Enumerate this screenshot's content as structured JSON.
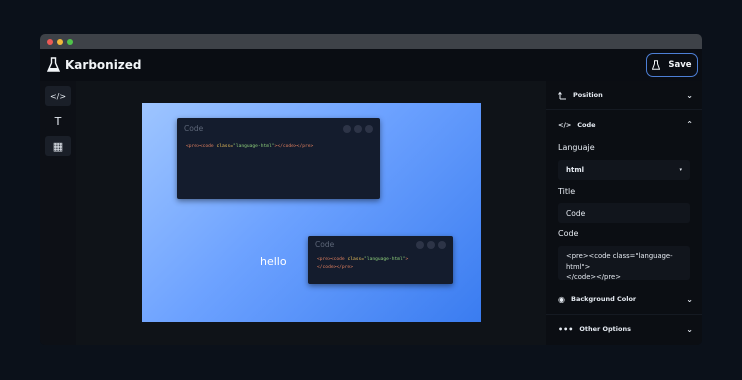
{
  "app": {
    "title": "Karbonized",
    "save_label": "Save"
  },
  "window_dots": [
    "#ec5a55",
    "#f2b83b",
    "#4fc44a"
  ],
  "toolbar": {
    "items": [
      {
        "icon": "code-icon",
        "glyph": "</>"
      },
      {
        "icon": "text-icon",
        "glyph": "T"
      },
      {
        "icon": "qr-code-icon",
        "glyph": "▦"
      }
    ]
  },
  "canvas": {
    "gradient": [
      "#9ec5ff",
      "#3a7cf0"
    ],
    "windows": [
      {
        "title": "Code",
        "lines": [
          [
            {
              "t": "<pre><code ",
              "c": "tag"
            },
            {
              "t": "class=",
              "c": "attr"
            },
            {
              "t": "\"language-html\"",
              "c": "str"
            },
            {
              "t": "></code></pre>",
              "c": "tag"
            }
          ]
        ]
      },
      {
        "title": "Code",
        "lines": [
          [
            {
              "t": "<pre><code ",
              "c": "tag"
            },
            {
              "t": "class=",
              "c": "attr"
            },
            {
              "t": "\"language-html\"",
              "c": "str"
            },
            {
              "t": ">",
              "c": "tag"
            }
          ],
          [
            {
              "t": "</code></pre>",
              "c": "tag"
            }
          ]
        ]
      }
    ],
    "text_label": "hello"
  },
  "panel": {
    "position_label": "Position",
    "code_label": "Code",
    "language_label": "Languaje",
    "language_value": "html",
    "title_label": "Title",
    "title_value": "Code",
    "code_field_label": "Code",
    "code_value": "<pre><code class=\"language-html\">\n</code></pre>",
    "background_label": "Background Color",
    "other_label": "Other Options"
  }
}
